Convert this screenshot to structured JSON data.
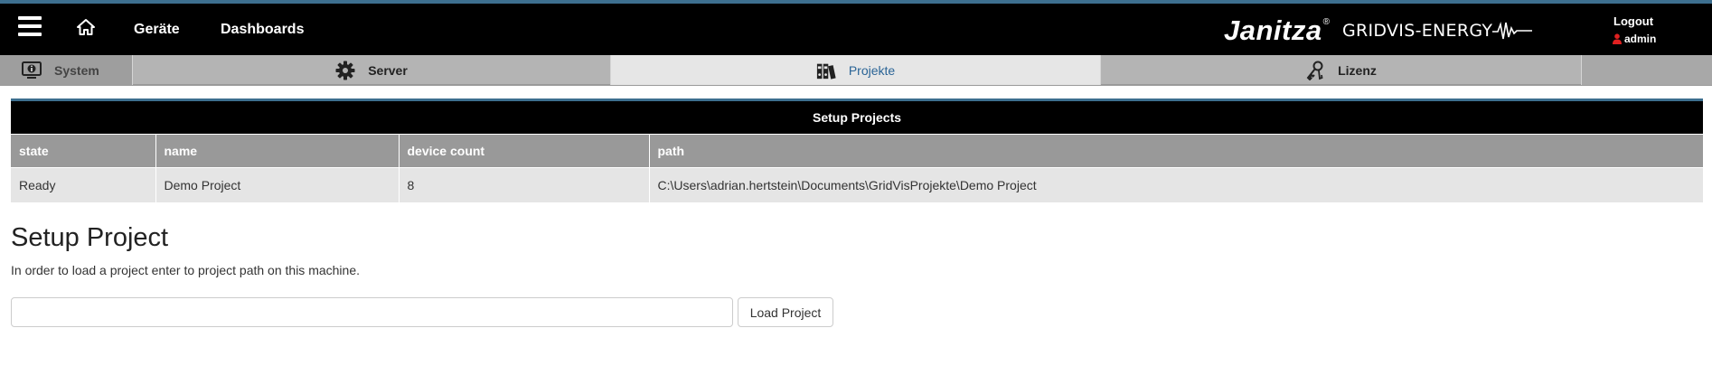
{
  "topbar": {
    "nav": {
      "geraete": "Geräte",
      "dashboards": "Dashboards"
    },
    "brand": {
      "name": "Janitza",
      "reg": "®",
      "product": "GRIDVIS-ENERGY"
    },
    "logout_label": "Logout",
    "user_name": "admin",
    "accent_color": "#3d6f8f"
  },
  "tabs": {
    "system": "System",
    "server": "Server",
    "projekte": "Projekte",
    "lizenz": "Lizenz",
    "active": "projekte"
  },
  "projects_table": {
    "title": "Setup Projects",
    "columns": [
      "state",
      "name",
      "device count",
      "path"
    ],
    "rows": [
      [
        "Ready",
        "Demo Project",
        "8",
        "C:\\Users\\adrian.hertstein\\Documents\\GridVisProjekte\\Demo Project"
      ]
    ]
  },
  "setup": {
    "title": "Setup Project",
    "description": "In order to load a project enter to project path on this machine.",
    "input_value": "",
    "button_label": "Load Project"
  }
}
